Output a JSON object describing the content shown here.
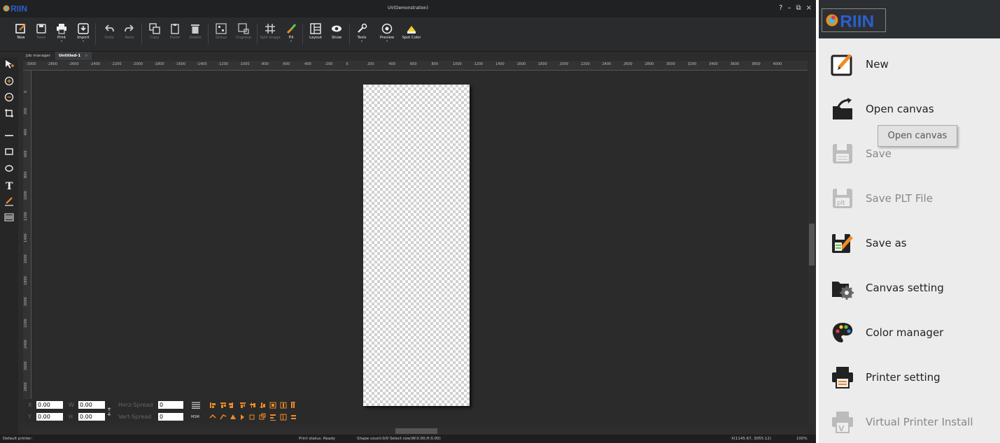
{
  "app": {
    "logo_text": "RIIN",
    "window_title": "UV(Demonstration)",
    "window_controls": [
      "?",
      "–",
      "⧉",
      "×"
    ]
  },
  "toolbar": {
    "items": [
      {
        "label": "New",
        "icon": "new-icon",
        "enabled": true
      },
      {
        "label": "Save",
        "icon": "save-icon",
        "enabled": false
      },
      {
        "label": "Print",
        "icon": "print-icon",
        "enabled": true,
        "dropdown": true
      },
      {
        "label": "Import",
        "icon": "import-icon",
        "enabled": true,
        "dropdown": true
      },
      {
        "label": "Undo",
        "icon": "undo-icon",
        "enabled": false
      },
      {
        "label": "Redo",
        "icon": "redo-icon",
        "enabled": false
      },
      {
        "label": "Copy",
        "icon": "copy-icon",
        "enabled": false
      },
      {
        "label": "Paste",
        "icon": "paste-icon",
        "enabled": false
      },
      {
        "label": "Delete",
        "icon": "delete-icon",
        "enabled": false
      },
      {
        "label": "Group",
        "icon": "group-icon",
        "enabled": false
      },
      {
        "label": "Ungroup",
        "icon": "ungroup-icon",
        "enabled": false
      },
      {
        "label": "Split image",
        "icon": "split-image-icon",
        "enabled": false
      },
      {
        "label": "Fill",
        "icon": "fill-icon",
        "enabled": true,
        "dropdown": true
      },
      {
        "label": "Layout",
        "icon": "layout-icon",
        "enabled": true
      },
      {
        "label": "Show",
        "icon": "show-icon",
        "enabled": true
      },
      {
        "label": "Tools",
        "icon": "tools-icon",
        "enabled": true,
        "dropdown": true
      },
      {
        "label": "Preview",
        "icon": "preview-icon",
        "enabled": true,
        "dropdown": true
      },
      {
        "label": "Spot Color",
        "icon": "spot-color-icon",
        "enabled": true
      }
    ]
  },
  "tabs": [
    {
      "label": "Job manager",
      "active": false
    },
    {
      "label": "Untitled-1",
      "active": true,
      "close": "×"
    }
  ],
  "rulers": {
    "horizontal": [
      "-3000",
      "-2800",
      "-2600",
      "-2400",
      "-2200",
      "-2000",
      "-1800",
      "-1600",
      "-1400",
      "-1200",
      "-1000",
      "-800",
      "-600",
      "-400",
      "-200",
      "0",
      "200",
      "400",
      "600",
      "800",
      "1000",
      "1200",
      "1400",
      "1600",
      "1800",
      "2000",
      "2200",
      "2400",
      "2600",
      "2800",
      "3000",
      "3200",
      "3400",
      "3600",
      "3800",
      "4000"
    ],
    "vertical": [
      "0",
      "200",
      "400",
      "600",
      "800",
      "1000",
      "1200",
      "1400",
      "1600",
      "1800",
      "2000",
      "2200",
      "2400",
      "2600",
      "2800"
    ]
  },
  "properties": {
    "x_label": "X",
    "x_value": "0.00",
    "y_label": "Y",
    "y_value": "0.00",
    "w_label": "W",
    "w_value": "0.00",
    "h_label": "H",
    "h_value": "0.00",
    "horz_spread_label": "Horz-Spread",
    "horz_spread_value": "0",
    "vert_spread_label": "Vert-Spread",
    "vert_spread_value": "0",
    "msm_label": "MSM"
  },
  "status": {
    "printer": "Default printer:",
    "print_status": "Print status: Ready",
    "shape_count": "Shape count:0/0  Select size(W:0.00,H:0.00)",
    "coords": "X(1145.67, 3055.12)",
    "zoom": "100%"
  },
  "menu": {
    "logo_text": "RIIN",
    "items": [
      {
        "label": "New",
        "icon": "new-icon",
        "enabled": true
      },
      {
        "label": "Open canvas",
        "icon": "open-canvas-icon",
        "enabled": true
      },
      {
        "label": "Save",
        "icon": "save-icon",
        "enabled": false
      },
      {
        "label": "Save PLT File",
        "icon": "save-plt-icon",
        "enabled": false
      },
      {
        "label": "Save as",
        "icon": "save-as-icon",
        "enabled": true
      },
      {
        "label": "Canvas setting",
        "icon": "canvas-setting-icon",
        "enabled": true
      },
      {
        "label": "Color manager",
        "icon": "palette-icon",
        "enabled": true
      },
      {
        "label": "Printer setting",
        "icon": "printer-setting-icon",
        "enabled": true
      },
      {
        "label": "Virtual Printer Install",
        "icon": "virtual-printer-icon",
        "enabled": false
      }
    ],
    "tooltip": "Open canvas"
  },
  "colors": {
    "accent_orange": "#f08a24",
    "logo_blue": "#2a5fcf",
    "toolbar_bg": "#2a2b2d",
    "menu_bg": "#ececec"
  }
}
